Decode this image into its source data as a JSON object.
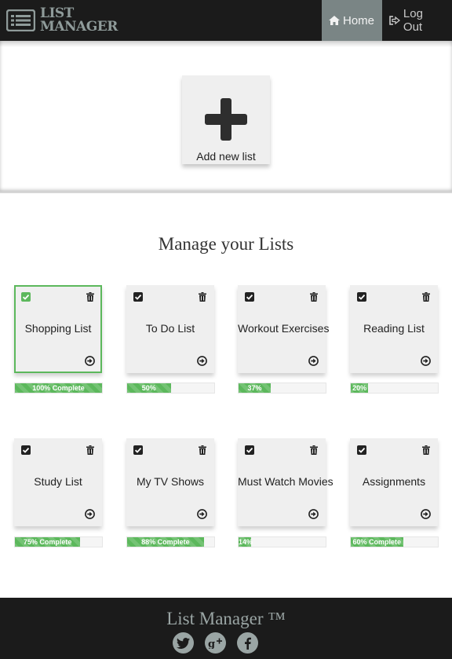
{
  "navbar": {
    "brand_line1": "LIST",
    "brand_line2": "MANAGER",
    "home_label": "Home",
    "logout_label": "Log Out"
  },
  "add_list": {
    "label": "Add new list"
  },
  "section_title": "Manage your Lists",
  "lists": [
    {
      "name": "Shopping List",
      "progress_percent": 100,
      "progress_label": "100% Complete",
      "selected": true
    },
    {
      "name": "To Do List",
      "progress_percent": 50,
      "progress_label": "50%",
      "selected": false
    },
    {
      "name": "Workout Exercises",
      "progress_percent": 37,
      "progress_label": "37%",
      "selected": false
    },
    {
      "name": "Reading List",
      "progress_percent": 20,
      "progress_label": "20%",
      "selected": false
    },
    {
      "name": "Study List",
      "progress_percent": 75,
      "progress_label": "75% Complete",
      "selected": false
    },
    {
      "name": "My TV Shows",
      "progress_percent": 88,
      "progress_label": "88% Complete",
      "selected": false
    },
    {
      "name": "Must Watch Movies",
      "progress_percent": 14,
      "progress_label": "14%",
      "selected": false
    },
    {
      "name": "Assignments",
      "progress_percent": 60,
      "progress_label": "60% Complete",
      "selected": false
    }
  ],
  "footer": {
    "title": "List Manager ™",
    "social_icons": [
      "twitter-icon",
      "google-plus-icon",
      "facebook-icon"
    ]
  },
  "colors": {
    "navbar_bg": "#1b1b1b",
    "nav_active_bg": "#7a8585",
    "brand_text": "#8f9b9a",
    "progress_green": "#5cb85c",
    "card_bg": "#efefef"
  }
}
